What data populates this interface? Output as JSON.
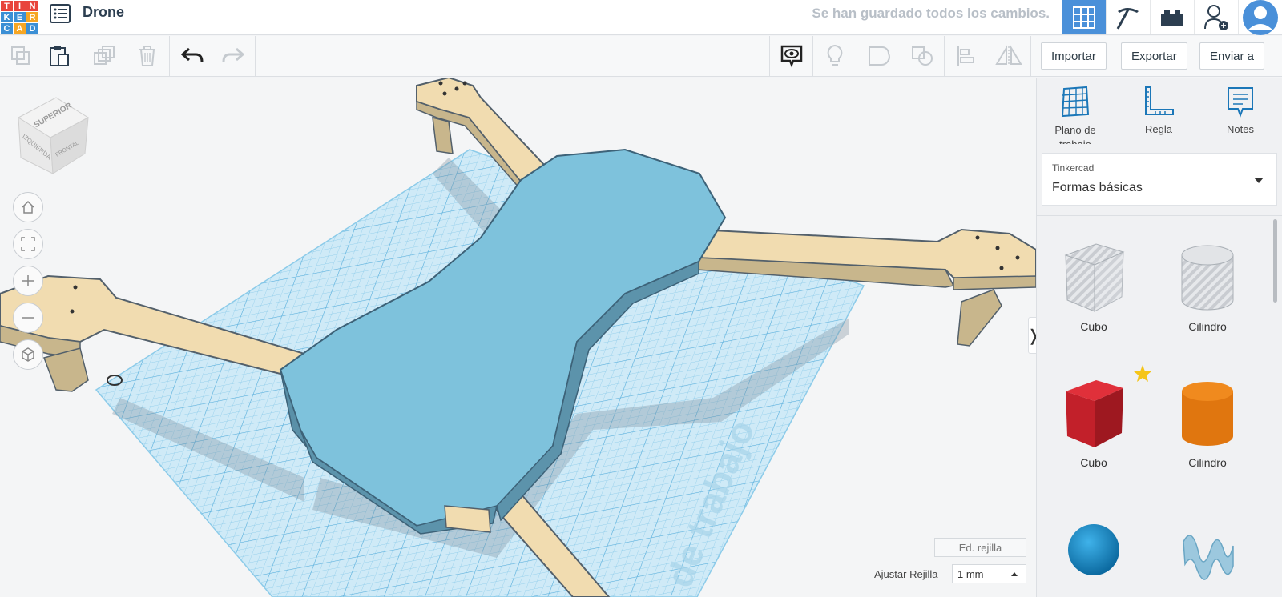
{
  "app": {
    "logo_letters": [
      "T",
      "I",
      "N",
      "K",
      "E",
      "R",
      "C",
      "A",
      "D"
    ],
    "logo_colors": [
      "#e8453c",
      "#e8453c",
      "#e8453c",
      "#3b8fd5",
      "#3b8fd5",
      "#f6a623",
      "#3b8fd5",
      "#f6a623",
      "#3b8fd5"
    ],
    "title": "Drone",
    "save_status": "Se han guardado todos los cambios."
  },
  "topbar_icons": [
    "grid-view-icon",
    "pickaxe-icon",
    "brick-icon",
    "add-user-icon",
    "avatar"
  ],
  "toolbar": {
    "import_label": "Importar",
    "export_label": "Exportar",
    "send_label": "Enviar a"
  },
  "panel": {
    "tools": [
      {
        "label": "Plano de trabajo",
        "icon": "workplane-icon"
      },
      {
        "label": "Regla",
        "icon": "ruler-icon"
      },
      {
        "label": "Notes",
        "icon": "notes-icon"
      }
    ],
    "library_source": "Tinkercad",
    "library_name": "Formas básicas",
    "shapes": [
      {
        "label": "Cubo",
        "kind": "hole-cube"
      },
      {
        "label": "Cilindro",
        "kind": "hole-cylinder"
      },
      {
        "label": "Cubo",
        "kind": "red-cube",
        "favorite": true
      },
      {
        "label": "Cilindro",
        "kind": "orange-cylinder"
      },
      {
        "label": "",
        "kind": "blue-sphere"
      },
      {
        "label": "",
        "kind": "blue-scribble"
      }
    ]
  },
  "viewcube": {
    "top": "SUPERIOR",
    "left": "IZQUIERDA",
    "front": "FRONTAL"
  },
  "workplane_watermark": "de trabajo",
  "grid": {
    "edit_label": "Ed. rejilla",
    "snap_label": "Ajustar Rejilla",
    "snap_value": "1 mm"
  },
  "colors": {
    "accent": "#4a90d9",
    "drone_body": "#7ec2dc",
    "drone_arm": "#f1dcb0",
    "workplane": "#bfe3f4"
  }
}
